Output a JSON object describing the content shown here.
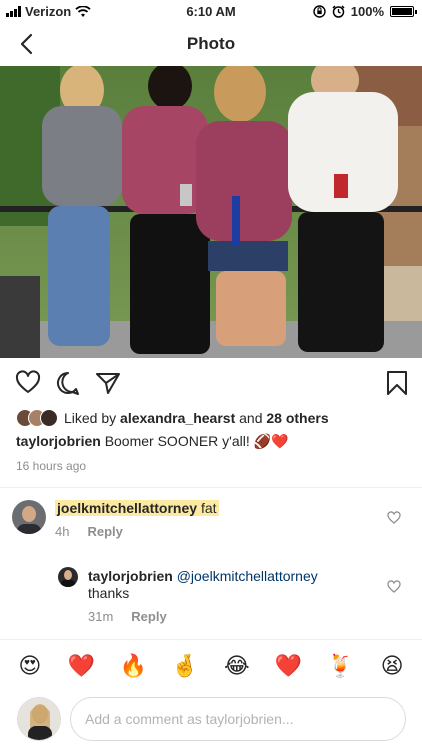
{
  "status_bar": {
    "carrier": "Verizon",
    "time": "6:10 AM",
    "battery": "100%",
    "battery_level": 1.0
  },
  "nav": {
    "title": "Photo"
  },
  "post": {
    "liked_by_prefix": "Liked by",
    "liked_by_user": "alexandra_hearst",
    "liked_by_and": "and",
    "liked_by_others": "28 others",
    "caption_user": "taylorjobrien",
    "caption_text": "Boomer SOONER y'all! 🏈❤️",
    "time_ago": "16 hours ago"
  },
  "comments": [
    {
      "username": "joelkmitchellattorney",
      "text": "fat",
      "time": "4h",
      "reply_label": "Reply"
    },
    {
      "username": "taylorjobrien",
      "mention": "@joelkmitchellattorney",
      "text": "thanks",
      "time": "31m",
      "reply_label": "Reply"
    }
  ],
  "emoji_bar": [
    "😍",
    "❤️",
    "🔥",
    "🤞",
    "😂",
    "❤️",
    "🍹",
    "😫"
  ],
  "comment_box": {
    "placeholder": "Add a comment as taylorjobrien..."
  }
}
